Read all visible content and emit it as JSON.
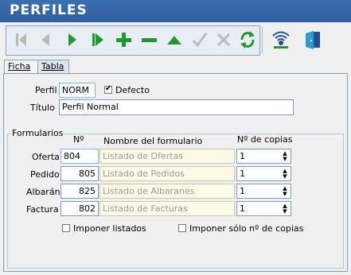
{
  "window": {
    "title": "PERFILES"
  },
  "toolbar": {
    "buttons": [
      "first-record",
      "previous-record",
      "next-record",
      "last-record",
      "add-record",
      "delete-record",
      "edit-record",
      "confirm",
      "cancel",
      "refresh",
      "connection",
      "exit"
    ]
  },
  "tabs": {
    "ficha": "Ficha",
    "tabla": "Tabla"
  },
  "profile": {
    "perfil_label": "Perfil",
    "perfil_value": "NORM",
    "defecto_label": "Defecto",
    "titulo_label": "Título",
    "titulo_value": "Perfil Normal"
  },
  "formularios": {
    "group_label": "Formularios",
    "col_num": "Nº",
    "col_name": "Nombre del formulario",
    "col_copies": "Nº de copias",
    "rows": [
      {
        "label": "Oferta",
        "num": "804",
        "name": "Listado de Ofertas",
        "copies": "1"
      },
      {
        "label": "Pedido",
        "num": "805",
        "name": "Listado de Pedidos",
        "copies": "1"
      },
      {
        "label": "Albarán",
        "num": "825",
        "name": "Listado de Albaranes",
        "copies": "1"
      },
      {
        "label": "Factura",
        "num": "802",
        "name": "Listado de Facturas",
        "copies": "1"
      }
    ],
    "imponer_listados": "Imponer listados",
    "imponer_copias": "Imponer sólo nº de copias"
  },
  "colors": {
    "title_bar": "#3b6fb1",
    "toolbar_green": "#1f9a2c",
    "toolbar_disabled": "#b7b7b7",
    "input_readonly": "#fdfbe7"
  }
}
